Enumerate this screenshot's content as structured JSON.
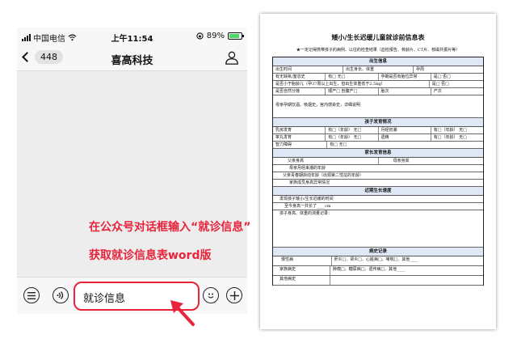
{
  "status": {
    "carrier": "中国电信",
    "time": "上午11:54",
    "battery": "89%",
    "battery_level": 0.89
  },
  "nav": {
    "back_count": "448",
    "title": "喜高科技"
  },
  "input": {
    "text": "就诊信息"
  },
  "annotations": {
    "line1": "在公众号对话框输入“就诊信息”",
    "line2": "获取就诊信息表word版"
  },
  "colors": {
    "accent_red": "#e8243b",
    "section_bg": "#dfe8f5"
  },
  "icons": [
    "wifi-icon",
    "battery-icon",
    "lock-rotation-icon",
    "back-chevron-icon",
    "profile-icon",
    "list-icon",
    "voice-icon",
    "emoji-icon",
    "add-icon",
    "arrow-icon"
  ],
  "document": {
    "title": "矮小/生长迟缓儿童就诊前信息表",
    "subtitle": "★一定记得携带孩子的病例、以往的检查结果（血检报告、骨龄片、CT片、核磁共振片等）",
    "sections": [
      {
        "heading": "出生信息",
        "rows": [
          [
            "出生时间",
            "出生身长、体重",
            "孕周"
          ],
          [
            "有无缺氧/窒息史",
            "有□ 无□",
            "孕期是否有胎位异常",
            "是□ 否□"
          ],
          [
            "是否小于胎龄儿（孕37周以上出生，但出生体重低于2.5kg）",
            "是□ 否□"
          ],
          [
            "是否自然分娩",
            "顺产□ 剖腹产□",
            "胎次",
            "产次"
          ],
          [
            "母亲孕期饮酒、吸烟史，宫内感染史，详细说明"
          ]
        ]
      },
      {
        "heading": "孩子发育情况",
        "rows": [
          [
            "乳房发育",
            "有□（年龄） 无□",
            "月经初潮",
            "有□（年龄） 无□"
          ],
          [
            "睾丸发育",
            "有□（年龄） 无□",
            "遗精",
            "有□（年龄） 无□"
          ],
          [
            "智力障碍",
            "有□ 无□"
          ]
        ]
      },
      {
        "heading": "家长发育信息",
        "rows": [
          [
            "父亲身高",
            "母亲身高"
          ],
          [
            "母亲月经来潮的年龄"
          ],
          [
            "父亲青春期启动年龄（出现第二性征的年龄）"
          ],
          [
            "家族成员身高异常情况"
          ]
        ]
      },
      {
        "heading": "近期生长速度",
        "rows": [
          [
            "发现孩子矮小/生长迟缓的时间"
          ],
          [
            "至今身高一共长了____cm"
          ],
          [
            "孩子身高、体重的测量记录："
          ]
        ]
      },
      {
        "heading": "病史记录",
        "rows": [
          [
            "慢性病",
            "肝炎□、肾炎□、心脏病□、哮喘□、其他____"
          ],
          [
            "家族病史",
            "肿瘤□、糖尿病□、遗传病□、其他____"
          ],
          [
            "其他病史"
          ]
        ]
      }
    ]
  }
}
